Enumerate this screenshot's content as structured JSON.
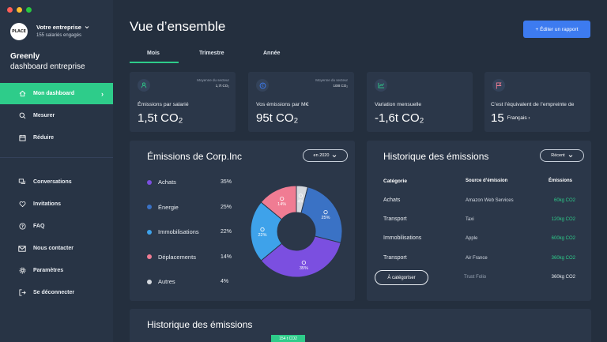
{
  "sidebar": {
    "company_name": "Votre entreprise",
    "company_sub": "155 salariés engagés",
    "logo_text": "PLACE",
    "brand_name": "Greenly",
    "brand_sub": "dashboard entreprise",
    "items": [
      {
        "label": "Mon dashboard",
        "icon": "home-icon"
      },
      {
        "label": "Mesurer",
        "icon": "search-icon"
      },
      {
        "label": "Réduire",
        "icon": "calendar-icon"
      },
      {
        "label": "Conversations",
        "icon": "chat-icon"
      },
      {
        "label": "Invitations",
        "icon": "heart-icon"
      },
      {
        "label": "FAQ",
        "icon": "question-icon"
      },
      {
        "label": "Nous contacter",
        "icon": "mail-icon"
      },
      {
        "label": "Paramètres",
        "icon": "gear-icon"
      },
      {
        "label": "Se déconnecter",
        "icon": "logout-icon"
      }
    ]
  },
  "header": {
    "title": "Vue d’ensemble",
    "edit_button": "+ Éditer un rapport",
    "tabs": [
      "Mois",
      "Trimestre",
      "Année"
    ],
    "active_tab": "Mois"
  },
  "stats": [
    {
      "icon": "person-icon",
      "meta_label": "Moyenne du secteur",
      "meta_value": "1,7t CO₂",
      "label": "Émissions par salarié",
      "value": "1,5t CO₂",
      "extra": ""
    },
    {
      "icon": "euro-icon",
      "meta_label": "Moyenne du secteur",
      "meta_value": "100t CO₂",
      "label": "Vos émissions par M€",
      "value": "95t CO₂",
      "extra": ""
    },
    {
      "icon": "chart-icon",
      "meta_label": "",
      "meta_value": "",
      "label": "Variation mensuelle",
      "value": "-1,6t CO₂",
      "extra": ""
    },
    {
      "icon": "flag-icon",
      "meta_label": "",
      "meta_value": "",
      "label": "C’est l’équivalent de l’empreinte de",
      "value": "15",
      "extra": "Français ›"
    }
  ],
  "emissions": {
    "title": "Émissions de Corp.Inc",
    "year_button": "en 2020",
    "legend": [
      {
        "label": "Achats",
        "pct": "35%",
        "color": "#7b4fe0"
      },
      {
        "label": "Énergie",
        "pct": "25%",
        "color": "#3a72c5"
      },
      {
        "label": "Immobilisations",
        "pct": "22%",
        "color": "#3ea2ea"
      },
      {
        "label": "Déplacements",
        "pct": "14%",
        "color": "#f07c93"
      },
      {
        "label": "Autres",
        "pct": "4%",
        "color": "#d5d9df"
      }
    ],
    "donut_labels": [
      "35%",
      "25%",
      "22%",
      "14%",
      "4%"
    ]
  },
  "history": {
    "title": "Historique des émissions",
    "filter_button": "Récent",
    "columns": [
      "Catégorie",
      "Source d’émission",
      "Émissions"
    ],
    "rows": [
      {
        "category": "Achats",
        "source": "Amazon Web Services",
        "emission": "60kg CO2"
      },
      {
        "category": "Transport",
        "source": "Taxi",
        "emission": "120kg CO2"
      },
      {
        "category": "Immobilisations",
        "source": "Apple",
        "emission": "600kg CO2"
      },
      {
        "category": "Transport",
        "source": "Air France",
        "emission": "360kg CO2"
      },
      {
        "category": "",
        "source": "Trust Folio",
        "emission": "360kg CO2"
      }
    ],
    "categorize_button": "À catégoriser"
  },
  "bottom": {
    "title": "Historique des émissions",
    "tag": "154 t CO2"
  }
}
